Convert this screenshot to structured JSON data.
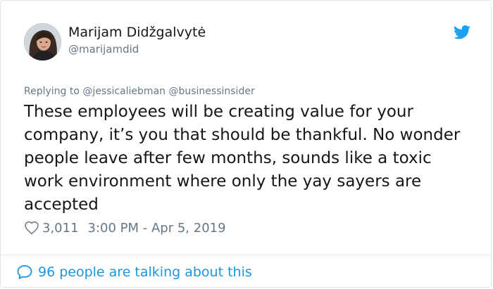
{
  "user": {
    "display_name": "Marijam Didžgalvytė",
    "handle": "@marijamdid",
    "avatar_icon": "avatar-photo"
  },
  "brand": {
    "logo_icon": "twitter-bird-icon",
    "color": "#1da1f2"
  },
  "reply": {
    "prefix": "Replying to",
    "mentions": [
      "@jessicaliebman",
      "@businessinsider"
    ]
  },
  "tweet": {
    "text": "These employees will be creating value for your company, it’s you that should be thankful. No wonder people leave after few months, sounds like a toxic work environment where only the yay sayers are accepted",
    "likes": "3,011",
    "timestamp": "3:00 PM - Apr 5, 2019"
  },
  "footer": {
    "talking_label": "96 people are talking about this",
    "icon": "comment-bubble-icon",
    "accent": "#1b95e0"
  }
}
